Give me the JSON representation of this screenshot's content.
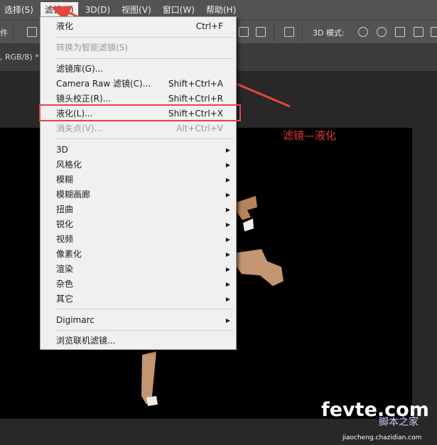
{
  "menubar": {
    "items": [
      {
        "label": "选择(S)"
      },
      {
        "label": "滤镜(T)"
      },
      {
        "label": "3D(D)"
      },
      {
        "label": "视图(V)"
      },
      {
        "label": "窗口(W)"
      },
      {
        "label": "帮助(H)"
      }
    ],
    "active": "滤镜(T)"
  },
  "options_bar": {
    "left_label": "件",
    "mode_label": "3D 模式:"
  },
  "document_tab": {
    "label": ", RGB/8) *"
  },
  "filter_menu": {
    "items": [
      {
        "label": "液化",
        "shortcut": "Ctrl+F"
      },
      {
        "label": "转换为智能滤镜(S)",
        "disabled": true
      },
      {
        "label": "滤镜库(G)..."
      },
      {
        "label": "Camera Raw 滤镜(C)...",
        "shortcut": "Shift+Ctrl+A"
      },
      {
        "label": "镜头校正(R)...",
        "shortcut": "Shift+Ctrl+R"
      },
      {
        "label": "液化(L)...",
        "shortcut": "Shift+Ctrl+X"
      },
      {
        "label": "消失点(V)...",
        "shortcut": "Alt+Ctrl+V",
        "disabled": true
      },
      {
        "label": "3D",
        "submenu": true
      },
      {
        "label": "风格化",
        "submenu": true
      },
      {
        "label": "模糊",
        "submenu": true
      },
      {
        "label": "模糊画廊",
        "submenu": true
      },
      {
        "label": "扭曲",
        "submenu": true
      },
      {
        "label": "锐化",
        "submenu": true
      },
      {
        "label": "视频",
        "submenu": true
      },
      {
        "label": "像素化",
        "submenu": true
      },
      {
        "label": "渲染",
        "submenu": true
      },
      {
        "label": "杂色",
        "submenu": true
      },
      {
        "label": "其它",
        "submenu": true
      },
      {
        "label": "Digimarc",
        "submenu": true
      },
      {
        "label": "浏览联机滤镜..."
      }
    ]
  },
  "annotation": {
    "caption": "滤镜—液化",
    "color": "#e03b32"
  },
  "watermark": {
    "main": "fevte.com",
    "sub": "脚本之家",
    "url": "jiaocheng.chazidian.com"
  }
}
